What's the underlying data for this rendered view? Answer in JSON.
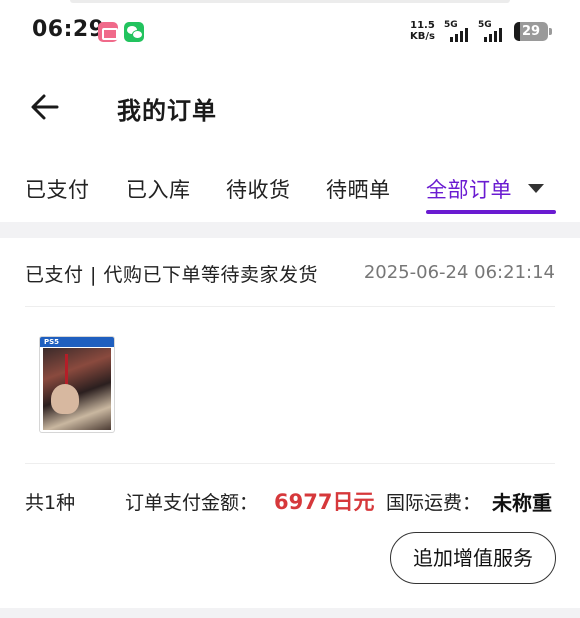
{
  "status_bar": {
    "time": "06:29",
    "network_speed_value": "11.5",
    "network_speed_unit": "KB/s",
    "signal_1_label": "5G",
    "signal_2_label": "5G",
    "battery": "29",
    "apps": [
      "bilibili-icon",
      "wechat-icon"
    ]
  },
  "header": {
    "title": "我的订单",
    "back_icon": "back-arrow-icon"
  },
  "tabs": [
    {
      "label": "已支付",
      "active": false
    },
    {
      "label": "已入库",
      "active": false
    },
    {
      "label": "待收货",
      "active": false
    },
    {
      "label": "待晒单",
      "active": false
    },
    {
      "label": "全部订单",
      "active": true
    }
  ],
  "order": {
    "status": "已支付 | 代购已下单等待卖家发货",
    "time": "2025-06-24 06:21:14",
    "item_count": "共1种",
    "pay_label": "订单支付金额：",
    "pay_amount": "6977日元",
    "shipping_label": "国际运费：",
    "shipping_value": "未称重",
    "service_button": "追加增值服务"
  },
  "colors": {
    "accent": "#6a1bd1",
    "price": "#d6383b",
    "divider": "#f2f2f4"
  }
}
